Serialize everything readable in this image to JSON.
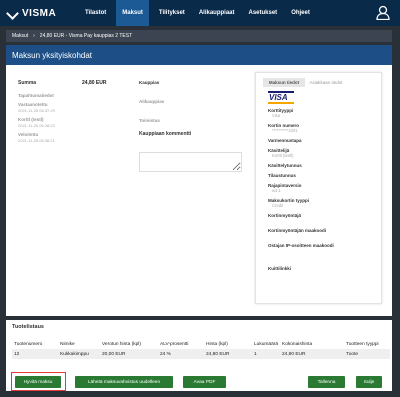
{
  "nav": {
    "logo": "VISMA",
    "items": [
      "Tilastot",
      "Maksut",
      "Tilitykset",
      "Alikauppiaat",
      "Asetukset",
      "Ohjeet"
    ]
  },
  "breadcrumb": {
    "root": "Maksut",
    "current": "24,80 EUR - Visma Pay kauppias 2 TEST"
  },
  "page_title": "Maksun yksityiskohdat",
  "summary": {
    "sum_label": "Summa",
    "sum_value": "24,80 EUR",
    "events_label": "Tapahtumatiedot",
    "events": [
      {
        "label": "Vastaanotettu",
        "time": "2021-11-26 06:37:29"
      },
      {
        "label": "Korttl (testl)",
        "time": "2021-11-26 06:38:22"
      },
      {
        "label": "Veloitetta",
        "time": "2021-11-26 06:38:21"
      }
    ]
  },
  "merchant": {
    "merchant_label": "Kauppias",
    "submerchant_label": "Alikauppias",
    "supplier_label": "Toimistus",
    "comment_label": "Kauppiaan kommentti"
  },
  "card_details": {
    "tabs": [
      "Maksun tiedot",
      "Asiakkaan tiedot"
    ],
    "brand": "VISA",
    "fields": [
      {
        "label": "Korttityyppi",
        "value": "Visa"
      },
      {
        "label": "Kortin numero",
        "value": "**********1001"
      },
      {
        "label": "Varmennustapa",
        "value": ""
      },
      {
        "label": "Käsittelijä",
        "value": "Korttl (testl)"
      },
      {
        "label": "Käsittelytunnus",
        "value": ""
      },
      {
        "label": "Tilaustunnus",
        "value": ""
      },
      {
        "label": "Rajapintaversio",
        "value": "w3.1"
      },
      {
        "label": "Maksukortin tyyppi",
        "value": "Credit"
      },
      {
        "label": "Kortinmyöntäjä",
        "value": ""
      },
      {
        "label": "Kortinmyöntäjän maakoodi",
        "value": ""
      },
      {
        "label": "Ostajan IP-osoitteen maakoodi",
        "value": ""
      },
      {
        "label": "Kuittilinkki",
        "value": ""
      }
    ]
  },
  "products": {
    "title": "Tuotelistaus",
    "headers": [
      "Tuotenumero",
      "Nimike",
      "Verotun hinta (kpl)",
      "ALV-prosentti",
      "Hinta (kpl)",
      "Lukumäärä",
      "Kokonaishinta",
      "Tuotteen tyyppi"
    ],
    "rows": [
      [
        "12",
        "Kukkakimppu",
        "20,00 EUR",
        "24 %",
        "24,80 EUR",
        "1",
        "24,80 EUR",
        "Tuote"
      ]
    ]
  },
  "buttons": {
    "refund": "Hyvitä maksu",
    "send_receipt": "Lähetä maksuvahvistus uudelleen",
    "open_pdf": "Avaa PDF",
    "save": "Tallenna",
    "close": "Sulje"
  },
  "colors": {
    "nav_bg": "#0a2a4a",
    "nav_active": "#1c5a95",
    "header_bg": "#1d4f86",
    "button_green": "#2b7a33",
    "highlight_red": "#e53935"
  }
}
